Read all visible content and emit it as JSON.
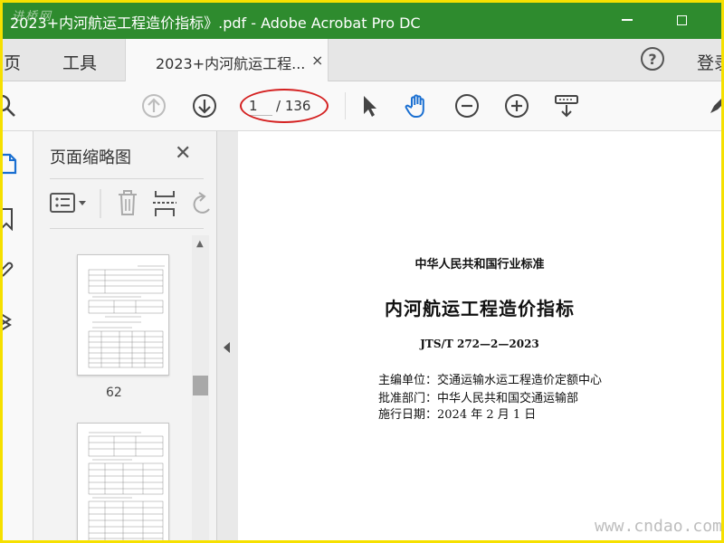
{
  "titlebar": {
    "title": "2023+内河航运工程造价指标》.pdf - Adobe Acrobat Pro DC",
    "watermark_logo": "进桥网"
  },
  "tabbar": {
    "home_label": "主页",
    "tools_label": "工具",
    "doc_tab_label": "2023+内河航运工程...",
    "close_glyph": "×",
    "help_glyph": "?",
    "signin_label": "登录"
  },
  "toolbar": {
    "current_page": "1",
    "total_pages": "/ 136"
  },
  "thumbnails_panel": {
    "title": "页面缩略图",
    "close_glyph": "✕",
    "thumbnails": [
      {
        "page_label": "62"
      }
    ]
  },
  "document": {
    "line1": "中华人民共和国行业标准",
    "title": "内河航运工程造价指标",
    "code": "JTS/T 272—2—2023",
    "editor": "主编单位：交通运输水运工程造价定额中心",
    "approver": "批准部门：中华人民共和国交通运输部",
    "effective": "施行日期：2024 年 2 月 1 日"
  },
  "watermark": "www.cndao.com",
  "colors": {
    "titlebar_bg": "#2e8b2e",
    "frame_border": "#f6e000",
    "annotation_oval": "#d42020",
    "hand_tool_active": "#1a6fd1"
  },
  "icons": {
    "prev_page": "arrow-up-circle-icon",
    "next_page": "arrow-down-circle-icon",
    "select": "pointer-arrow-icon",
    "hand": "hand-icon",
    "zoom_out": "minus-circle-icon",
    "zoom_in": "plus-circle-icon",
    "scroll_mode": "scroll-mode-icon"
  }
}
